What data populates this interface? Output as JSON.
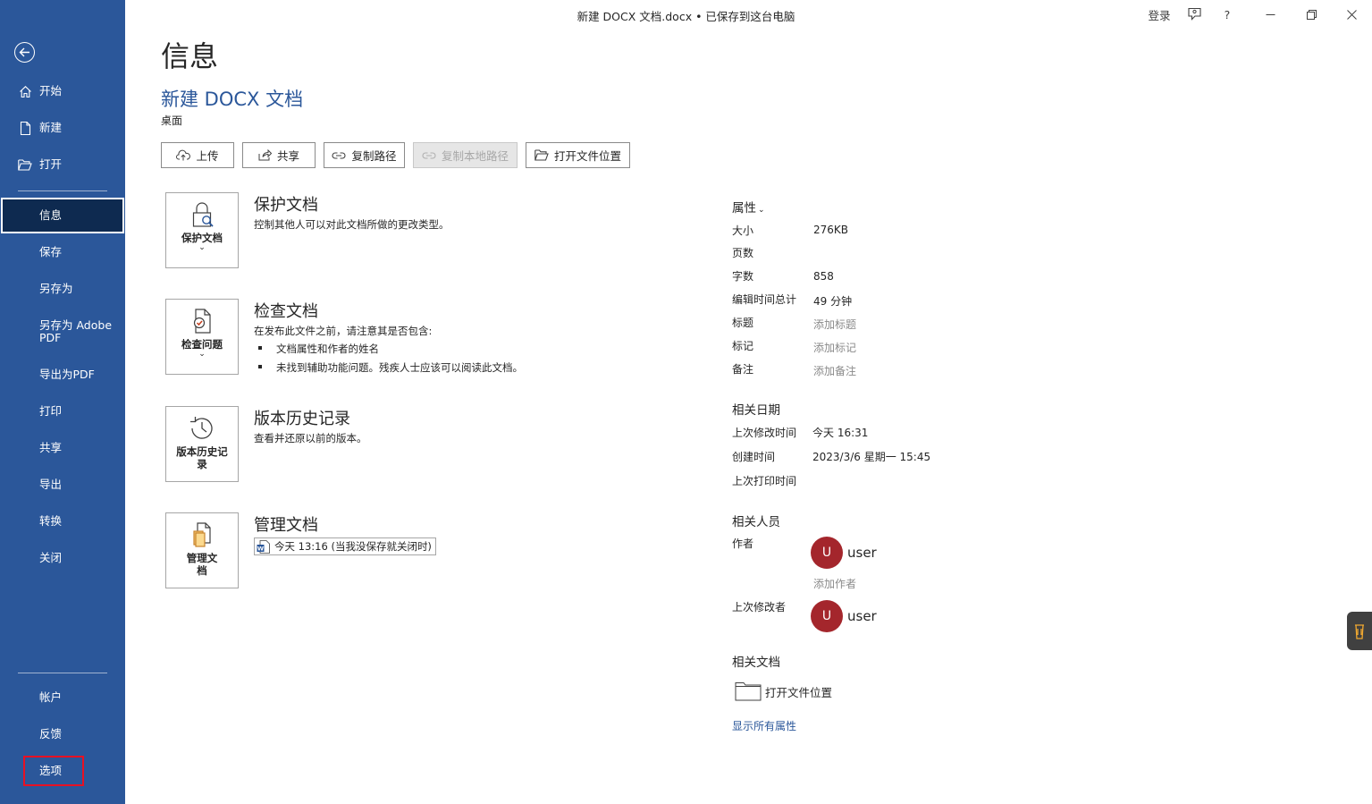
{
  "window": {
    "title": "新建 DOCX 文档.docx • 已保存到这台电脑",
    "signin_label": "登录",
    "help_label": "?"
  },
  "sidebar": {
    "top_items": [
      {
        "label": "开始",
        "icon": "home-icon"
      },
      {
        "label": "新建",
        "icon": "new-document-icon"
      },
      {
        "label": "打开",
        "icon": "open-folder-icon"
      }
    ],
    "items": [
      {
        "label": "信息",
        "active": true
      },
      {
        "label": "保存"
      },
      {
        "label": "另存为"
      },
      {
        "label": "另存为 Adobe PDF"
      },
      {
        "label": "导出为PDF"
      },
      {
        "label": "打印"
      },
      {
        "label": "共享"
      },
      {
        "label": "导出"
      },
      {
        "label": "转换"
      },
      {
        "label": "关闭"
      }
    ],
    "bottom_items": [
      {
        "label": "帐户"
      },
      {
        "label": "反馈"
      },
      {
        "label": "选项",
        "highlighted": true
      }
    ]
  },
  "main": {
    "page_title": "信息",
    "doc_title": "新建 DOCX 文档",
    "doc_location": "桌面",
    "actions": [
      {
        "label": "上传",
        "icon": "cloud-upload-icon"
      },
      {
        "label": "共享",
        "icon": "share-icon"
      },
      {
        "label": "复制路径",
        "icon": "link-icon"
      },
      {
        "label": "复制本地路径",
        "icon": "link-icon",
        "disabled": true
      },
      {
        "label": "打开文件位置",
        "icon": "folder-icon"
      }
    ],
    "sections": {
      "protect": {
        "button": "保护文档",
        "title": "保护文档",
        "desc": "控制其他人可以对此文档所做的更改类型。"
      },
      "inspect": {
        "button": "检查问题",
        "title": "检查文档",
        "desc": "在发布此文件之前，请注意其是否包含:",
        "bullets": [
          "文档属性和作者的姓名",
          "未找到辅助功能问题。残疾人士应该可以阅读此文档。"
        ]
      },
      "history": {
        "button": "版本历史记录",
        "title": "版本历史记录",
        "desc": "查看并还原以前的版本。"
      },
      "manage": {
        "button": "管理文档",
        "title": "管理文档",
        "version_entry": "今天 13:16 (当我没保存就关闭时)"
      }
    }
  },
  "properties": {
    "heading": "属性",
    "rows": [
      {
        "label": "大小",
        "value": "276KB"
      },
      {
        "label": "页数",
        "value": ""
      },
      {
        "label": "字数",
        "value": "858"
      },
      {
        "label": "编辑时间总计",
        "value": "49 分钟"
      },
      {
        "label": "标题",
        "value": "添加标题",
        "placeholder": true
      },
      {
        "label": "标记",
        "value": "添加标记",
        "placeholder": true
      },
      {
        "label": "备注",
        "value": "添加备注",
        "placeholder": true
      }
    ],
    "dates_heading": "相关日期",
    "dates": [
      {
        "label": "上次修改时间",
        "value": "今天 16:31"
      },
      {
        "label": "创建时间",
        "value": "2023/3/6 星期一 15:45"
      },
      {
        "label": "上次打印时间",
        "value": ""
      }
    ],
    "people_heading": "相关人员",
    "author_label": "作者",
    "author": {
      "initial": "U",
      "name": "user"
    },
    "add_author": "添加作者",
    "last_modified_by_label": "上次修改者",
    "last_modified_by": {
      "initial": "U",
      "name": "user"
    },
    "related_docs_heading": "相关文档",
    "open_location": "打开文件位置",
    "show_all": "显示所有属性"
  },
  "colors": {
    "sidebar": "#2b579a",
    "active_item": "#0e2a50",
    "accent": "#2b579a",
    "avatar": "#a4262c",
    "highlight_box": "#e81123"
  }
}
